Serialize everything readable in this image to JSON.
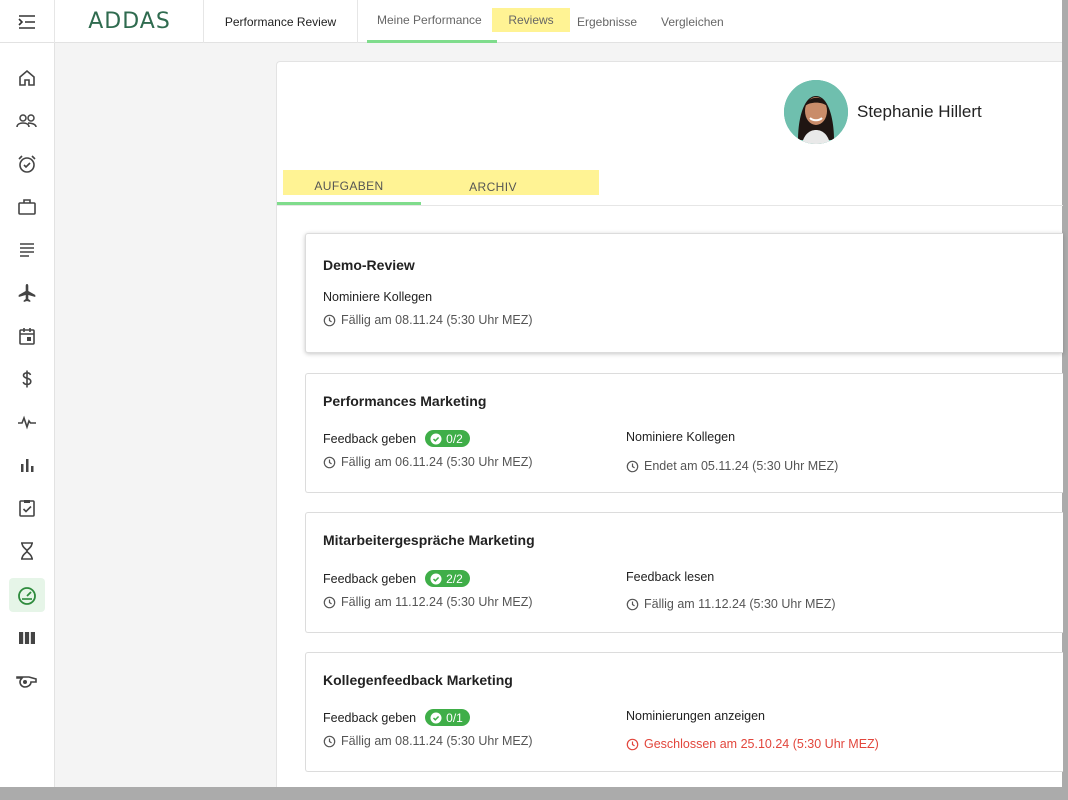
{
  "app": {
    "logo_text": "ADDAS",
    "module_title": "Performance Review"
  },
  "nav": {
    "tabs": [
      {
        "label": "Meine Performance"
      },
      {
        "label": "Reviews"
      },
      {
        "label": "Ergebnisse"
      },
      {
        "label": "Vergleichen"
      }
    ]
  },
  "sidebar": {
    "items": [
      "home-icon",
      "people-icon",
      "alarm-clock-icon",
      "briefcase-icon",
      "notes-icon",
      "airplane-icon",
      "calendar-icon",
      "dollar-icon",
      "pulse-icon",
      "bar-chart-icon",
      "checklist-icon",
      "hourglass-icon",
      "speedometer-icon",
      "columns-icon",
      "whistle-icon"
    ],
    "active_index": 12
  },
  "profile": {
    "name": "Stephanie Hillert"
  },
  "subtabs": [
    {
      "label": "AUFGABEN"
    },
    {
      "label": "ARCHIV"
    }
  ],
  "cards": [
    {
      "title": "Demo-Review",
      "left": {
        "task": "Nominiere Kollegen",
        "due": "Fällig am 08.11.24 (5:30 Uhr MEZ)"
      }
    },
    {
      "title": "Performances Marketing",
      "left": {
        "task": "Feedback geben",
        "badge": "0/2",
        "due": "Fällig am 06.11.24 (5:30 Uhr MEZ)"
      },
      "right": {
        "task": "Nominiere Kollegen",
        "due": "Endet am 05.11.24 (5:30 Uhr MEZ)"
      }
    },
    {
      "title": "Mitarbeitergespräche Marketing",
      "left": {
        "task": "Feedback geben",
        "badge": "2/2",
        "due": "Fällig am 11.12.24 (5:30 Uhr MEZ)"
      },
      "right": {
        "task": "Feedback lesen",
        "due": "Fällig am 11.12.24 (5:30 Uhr MEZ)"
      }
    },
    {
      "title": "Kollegenfeedback Marketing",
      "left": {
        "task": "Feedback geben",
        "badge": "0/1",
        "due": "Fällig am 08.11.24 (5:30 Uhr MEZ)"
      },
      "right": {
        "task": "Nominierungen anzeigen",
        "due": "Geschlossen am 25.10.24 (5:30 Uhr MEZ)",
        "due_color": "#e2463c"
      }
    }
  ],
  "colors": {
    "accent_green": "#7fdc8c",
    "badge_green": "#3fae48",
    "highlight": "#fff394",
    "error_red": "#e2463c"
  }
}
